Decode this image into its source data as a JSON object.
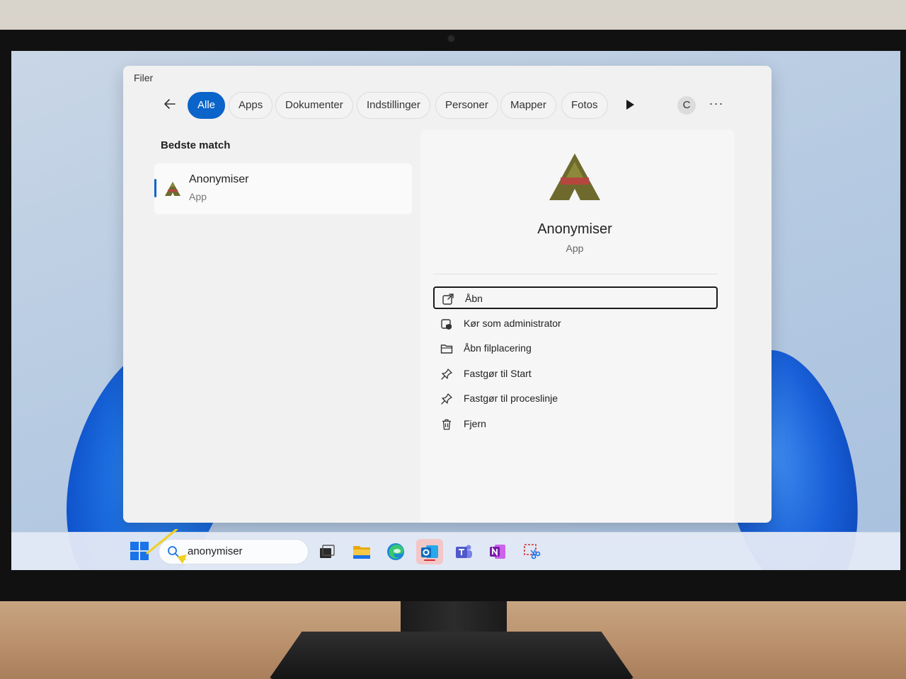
{
  "panel": {
    "header": "Filer",
    "filters": [
      "Alle",
      "Apps",
      "Dokumenter",
      "Indstillinger",
      "Personer",
      "Mapper",
      "Fotos"
    ],
    "avatar_initial": "C",
    "more_label": "···"
  },
  "best_match": {
    "section_title": "Bedste match",
    "name": "Anonymiser",
    "type": "App"
  },
  "detail": {
    "name": "Anonymiser",
    "type": "App",
    "actions": [
      {
        "label": "Åbn",
        "icon": "open-external-icon"
      },
      {
        "label": "Kør som administrator",
        "icon": "shield-admin-icon"
      },
      {
        "label": "Åbn filplacering",
        "icon": "folder-icon"
      },
      {
        "label": "Fastgør til Start",
        "icon": "pin-icon"
      },
      {
        "label": "Fastgør til proceslinje",
        "icon": "pin-icon"
      },
      {
        "label": "Fjern",
        "icon": "trash-icon"
      }
    ]
  },
  "taskbar": {
    "search_value": "anonymiser",
    "apps": [
      "task-view",
      "file-explorer",
      "edge",
      "outlook",
      "teams",
      "onenote",
      "snipping-tool"
    ],
    "active_app": "outlook"
  },
  "colors": {
    "accent": "#0a64c9",
    "logo_olive": "#6e6a2e",
    "logo_red": "#b5473f"
  }
}
